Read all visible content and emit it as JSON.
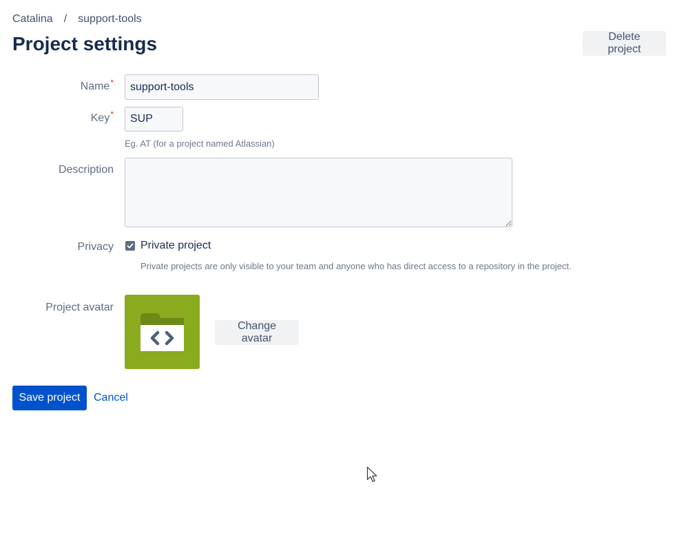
{
  "breadcrumb": {
    "project": "Catalina",
    "separator": "/",
    "repo": "support-tools"
  },
  "header": {
    "title": "Project settings",
    "delete_label": "Delete project"
  },
  "form": {
    "name": {
      "label": "Name",
      "required_mark": "*",
      "value": "support-tools"
    },
    "key": {
      "label": "Key",
      "required_mark": "*",
      "value": "SUP",
      "help": "Eg. AT (for a project named Atlassian)"
    },
    "description": {
      "label": "Description",
      "value": ""
    },
    "privacy": {
      "label": "Privacy",
      "checkbox_label": "Private project",
      "checked": true,
      "help": "Private projects are only visible to your team and anyone who has direct access to a repository in the project."
    },
    "avatar": {
      "label": "Project avatar",
      "icon": "folder-code-icon",
      "background_color": "#8aab1d",
      "change_label": "Change avatar"
    }
  },
  "actions": {
    "save_label": "Save project",
    "cancel_label": "Cancel"
  },
  "colors": {
    "primary": "#0052cc",
    "required": "#de350b",
    "avatar_bg": "#8aab1d"
  }
}
